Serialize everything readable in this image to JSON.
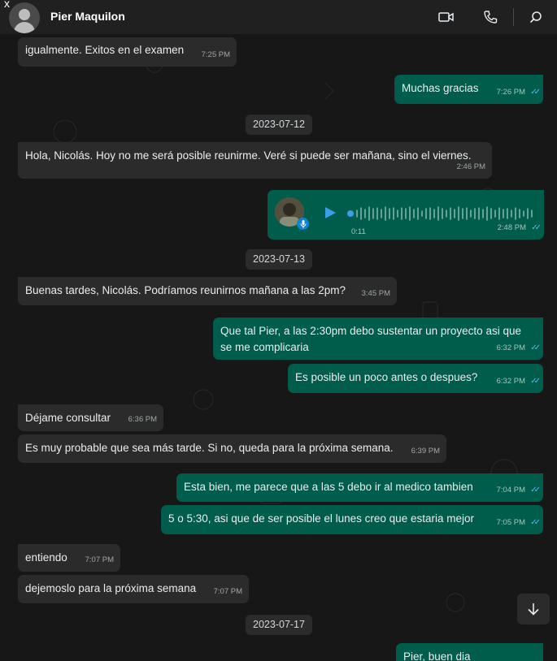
{
  "header": {
    "contact_name": "Pier Maquilon",
    "close_glyph": "x",
    "icons": [
      "video-call-icon",
      "voice-call-icon",
      "search-icon"
    ]
  },
  "colors": {
    "incoming_bubble": "#2b2b2b",
    "outgoing_bubble": "#005c4b",
    "read_ticks": "#53bdeb",
    "background": "#171717"
  },
  "messages": [
    {
      "dir": "in",
      "text": "igualmente. Exitos en el examen",
      "time": "7:25 PM"
    },
    {
      "dir": "out",
      "text": "Muchas gracias",
      "time": "7:26 PM"
    },
    {
      "date": "2023-07-12"
    },
    {
      "dir": "in",
      "text": "Hola, Nicolás. Hoy no me será posible reunirme. Veré si puede ser mañana, sino el viernes.",
      "time": "2:46 PM"
    },
    {
      "dir": "out",
      "voice": true,
      "duration": "0:11",
      "time": "2:48 PM"
    },
    {
      "date": "2023-07-13"
    },
    {
      "dir": "in",
      "text": "Buenas tardes, Nicolás. Podríamos reunirnos mañana a las 2pm?",
      "time": "3:45 PM"
    },
    {
      "dir": "out",
      "text": "Que tal Pier, a las 2:30pm debo sustentar un proyecto asi que se me complicaria",
      "time": "6:32 PM"
    },
    {
      "dir": "out",
      "text": "Es posible un poco antes o despues?",
      "time": "6:32 PM"
    },
    {
      "dir": "in",
      "text": "Déjame consultar",
      "time": "6:36 PM"
    },
    {
      "dir": "in",
      "text": "Es muy probable que sea más tarde. Si no, queda para la próxima semana.",
      "time": "6:39 PM"
    },
    {
      "dir": "out",
      "text": "Esta bien, me parece que a las 5 debo ir al medico tambien",
      "time": "7:04 PM"
    },
    {
      "dir": "out",
      "text": "5 o 5:30, asi que de ser posible el lunes creo que estaria mejor",
      "time": "7:05 PM"
    },
    {
      "dir": "in",
      "text": "entiendo",
      "time": "7:07 PM"
    },
    {
      "dir": "in",
      "text": "dejemoslo para la próxima semana",
      "time": "7:07 PM"
    },
    {
      "date": "2023-07-17"
    },
    {
      "dir": "out",
      "text": "Pier, buen dia",
      "time": ""
    }
  ]
}
